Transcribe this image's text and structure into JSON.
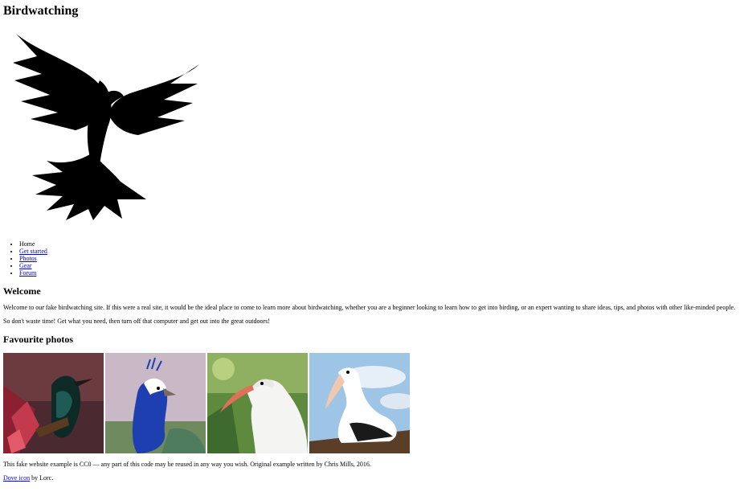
{
  "header": {
    "title": "Birdwatching"
  },
  "logo": {
    "icon": "dove-icon",
    "color": "#000000"
  },
  "nav": {
    "items": [
      {
        "label": "Home",
        "link": false
      },
      {
        "label": "Get started",
        "link": true
      },
      {
        "label": "Photos",
        "link": true
      },
      {
        "label": "Gear",
        "link": true
      },
      {
        "label": "Forum",
        "link": true
      }
    ]
  },
  "welcome": {
    "heading": "Welcome",
    "para1": "Welcome to our fake birdwatching site. If this were a real site, it would be the ideal place to come to learn more about birdwatching, whether you are a beginner looking to learn how to get into birding, or an expert wanting to share ideas, tips, and photos with other like-minded people.",
    "para2": "So don't waste time! Get what you need, then turn off that computer and get out into the great outdoors!"
  },
  "photos": {
    "heading": "Favourite photos",
    "items": [
      {
        "name": "tui-photo"
      },
      {
        "name": "peacock-photo"
      },
      {
        "name": "ibis-photo"
      },
      {
        "name": "pelican-photo"
      }
    ]
  },
  "footer": {
    "credit": "This fake website example is CC0 — any part of this code may be reused in any way you wish. Original example written by Chris Mills, 2016.",
    "icon_link": "Dove icon",
    "icon_by": " by Lorc."
  }
}
